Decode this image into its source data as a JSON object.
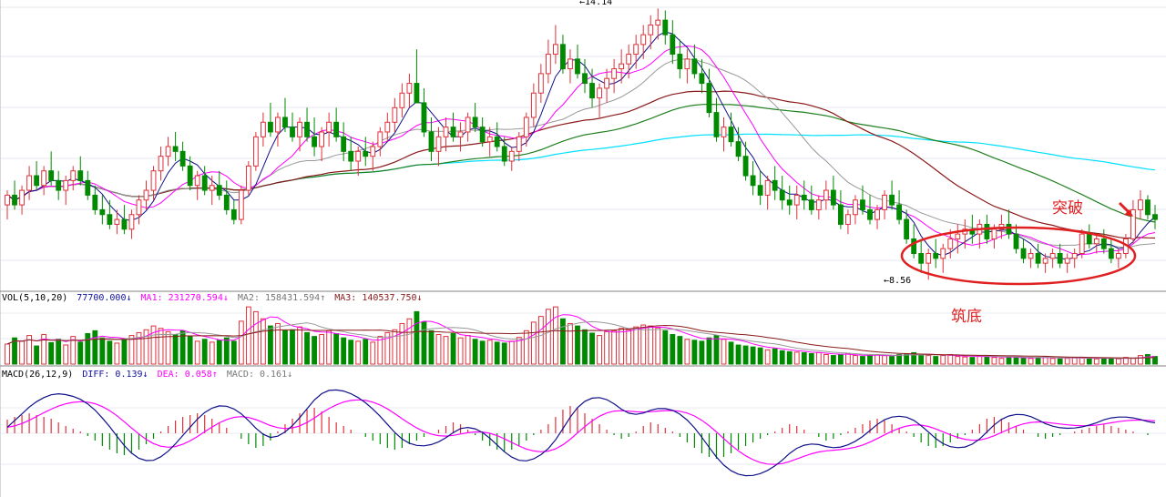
{
  "chart_data": {
    "type": "candlestick",
    "price_panel": {
      "high_label": "14.14",
      "low_label": "8.56",
      "annotation_breakout": "突破",
      "annotation_base": "筑底",
      "colors": {
        "up": "#e0303a",
        "down": "#008a00",
        "ma_short": "#10108a",
        "ma_mid": "#ff00ff",
        "ma_gray": "#999999",
        "ma_long_red": "#8b1a1a",
        "ma_long_green": "#208020",
        "ma_long_cyan": "#00e0ff",
        "circle": "#e02020"
      }
    },
    "volume_panel": {
      "header": "VOL(5,10,20)",
      "vol_value": "77700.000↓",
      "ma1": "MA1: 231270.594↓",
      "ma2": "MA2: 158431.594↑",
      "ma3": "MA3: 140537.750↓"
    },
    "macd_panel": {
      "header": "MACD(26,12,9)",
      "diff": "DIFF: 0.139↓",
      "dea": "DEA: 0.058↑",
      "macd": "MACD: 0.161↓"
    },
    "ohlc": [
      [
        10.1,
        10.4,
        9.8,
        10.3
      ],
      [
        10.3,
        10.6,
        10.0,
        10.1
      ],
      [
        10.1,
        10.5,
        9.9,
        10.4
      ],
      [
        10.4,
        10.9,
        10.2,
        10.7
      ],
      [
        10.7,
        11.0,
        10.4,
        10.5
      ],
      [
        10.5,
        10.9,
        10.3,
        10.8
      ],
      [
        10.8,
        11.2,
        10.5,
        10.6
      ],
      [
        10.6,
        10.8,
        10.2,
        10.4
      ],
      [
        10.4,
        10.7,
        10.1,
        10.6
      ],
      [
        10.6,
        10.9,
        10.4,
        10.8
      ],
      [
        10.8,
        11.1,
        10.5,
        10.6
      ],
      [
        10.6,
        10.8,
        10.2,
        10.3
      ],
      [
        10.3,
        10.5,
        9.9,
        10.0
      ],
      [
        10.0,
        10.3,
        9.7,
        9.9
      ],
      [
        9.9,
        10.2,
        9.6,
        9.7
      ],
      [
        9.7,
        10.0,
        9.5,
        9.8
      ],
      [
        9.8,
        10.1,
        9.5,
        9.6
      ],
      [
        9.6,
        10.0,
        9.4,
        9.9
      ],
      [
        9.9,
        10.3,
        9.7,
        10.2
      ],
      [
        10.2,
        10.6,
        10.0,
        10.4
      ],
      [
        10.4,
        10.9,
        10.2,
        10.8
      ],
      [
        10.8,
        11.3,
        10.6,
        11.1
      ],
      [
        11.1,
        11.5,
        10.9,
        11.3
      ],
      [
        11.3,
        11.6,
        11.0,
        11.2
      ],
      [
        11.2,
        11.4,
        10.8,
        10.9
      ],
      [
        10.9,
        11.1,
        10.4,
        10.5
      ],
      [
        10.5,
        10.8,
        10.2,
        10.7
      ],
      [
        10.7,
        10.9,
        10.3,
        10.4
      ],
      [
        10.4,
        10.7,
        10.1,
        10.5
      ],
      [
        10.5,
        10.8,
        10.2,
        10.3
      ],
      [
        10.3,
        10.6,
        9.9,
        10.0
      ],
      [
        10.0,
        10.2,
        9.7,
        9.8
      ],
      [
        9.8,
        10.5,
        9.7,
        10.4
      ],
      [
        10.4,
        11.0,
        10.3,
        10.9
      ],
      [
        10.9,
        11.6,
        10.8,
        11.5
      ],
      [
        11.5,
        12.0,
        11.3,
        11.8
      ],
      [
        11.8,
        12.2,
        11.5,
        11.6
      ],
      [
        11.6,
        12.0,
        11.3,
        11.9
      ],
      [
        11.9,
        12.3,
        11.6,
        11.7
      ],
      [
        11.7,
        12.0,
        11.4,
        11.5
      ],
      [
        11.5,
        11.9,
        11.2,
        11.8
      ],
      [
        11.8,
        12.1,
        11.4,
        11.5
      ],
      [
        11.5,
        11.9,
        11.1,
        11.3
      ],
      [
        11.3,
        11.7,
        11.0,
        11.6
      ],
      [
        11.6,
        12.0,
        11.3,
        11.8
      ],
      [
        11.8,
        12.1,
        11.4,
        11.5
      ],
      [
        11.5,
        11.8,
        11.0,
        11.2
      ],
      [
        11.2,
        11.5,
        10.8,
        11.0
      ],
      [
        11.0,
        11.3,
        10.7,
        11.2
      ],
      [
        11.2,
        11.5,
        10.9,
        11.1
      ],
      [
        11.1,
        11.4,
        10.8,
        11.3
      ],
      [
        11.3,
        11.7,
        11.1,
        11.6
      ],
      [
        11.6,
        12.0,
        11.4,
        11.8
      ],
      [
        11.8,
        12.3,
        11.6,
        12.1
      ],
      [
        12.1,
        12.6,
        11.9,
        12.4
      ],
      [
        12.4,
        12.8,
        12.1,
        12.6
      ],
      [
        12.6,
        13.3,
        12.4,
        12.2
      ],
      [
        12.2,
        12.5,
        11.5,
        11.6
      ],
      [
        11.6,
        11.9,
        11.0,
        11.2
      ],
      [
        11.2,
        11.7,
        10.9,
        11.5
      ],
      [
        11.5,
        11.9,
        11.2,
        11.7
      ],
      [
        11.7,
        12.0,
        11.4,
        11.5
      ],
      [
        11.5,
        11.8,
        11.2,
        11.6
      ],
      [
        11.6,
        12.0,
        11.4,
        11.9
      ],
      [
        11.9,
        12.2,
        11.6,
        11.7
      ],
      [
        11.7,
        11.9,
        11.3,
        11.4
      ],
      [
        11.4,
        11.7,
        11.1,
        11.5
      ],
      [
        11.5,
        11.8,
        11.2,
        11.3
      ],
      [
        11.3,
        11.5,
        10.9,
        11.0
      ],
      [
        11.0,
        11.3,
        10.8,
        11.2
      ],
      [
        11.2,
        11.6,
        11.0,
        11.5
      ],
      [
        11.5,
        12.0,
        11.3,
        11.9
      ],
      [
        11.9,
        12.6,
        11.7,
        12.4
      ],
      [
        12.4,
        13.0,
        12.2,
        12.8
      ],
      [
        12.8,
        13.5,
        12.6,
        13.2
      ],
      [
        13.2,
        13.8,
        13.0,
        13.4
      ],
      [
        13.4,
        13.6,
        12.8,
        12.9
      ],
      [
        12.9,
        13.3,
        12.6,
        13.1
      ],
      [
        13.1,
        13.4,
        12.7,
        12.8
      ],
      [
        12.8,
        13.1,
        12.4,
        12.6
      ],
      [
        12.6,
        12.9,
        12.1,
        12.3
      ],
      [
        12.3,
        12.6,
        11.9,
        12.5
      ],
      [
        12.5,
        12.9,
        12.2,
        12.7
      ],
      [
        12.7,
        13.1,
        12.4,
        12.9
      ],
      [
        12.9,
        13.3,
        12.6,
        13.0
      ],
      [
        13.0,
        13.4,
        12.7,
        13.2
      ],
      [
        13.2,
        13.6,
        12.9,
        13.4
      ],
      [
        13.4,
        13.8,
        13.1,
        13.6
      ],
      [
        13.6,
        14.0,
        13.3,
        13.8
      ],
      [
        13.8,
        14.14,
        13.5,
        13.9
      ],
      [
        13.9,
        14.1,
        13.4,
        13.6
      ],
      [
        13.6,
        13.9,
        13.0,
        13.2
      ],
      [
        13.2,
        13.5,
        12.7,
        12.9
      ],
      [
        12.9,
        13.3,
        12.6,
        13.1
      ],
      [
        13.1,
        13.4,
        12.7,
        12.8
      ],
      [
        12.8,
        13.1,
        12.4,
        12.6
      ],
      [
        12.6,
        12.9,
        11.9,
        12.0
      ],
      [
        12.0,
        12.3,
        11.4,
        11.5
      ],
      [
        11.5,
        11.9,
        11.2,
        11.7
      ],
      [
        11.7,
        12.0,
        11.3,
        11.4
      ],
      [
        11.4,
        11.7,
        11.0,
        11.1
      ],
      [
        11.1,
        11.4,
        10.6,
        10.7
      ],
      [
        10.7,
        11.0,
        10.3,
        10.5
      ],
      [
        10.5,
        10.8,
        10.1,
        10.3
      ],
      [
        10.3,
        10.7,
        10.0,
        10.6
      ],
      [
        10.6,
        10.9,
        10.2,
        10.4
      ],
      [
        10.4,
        10.7,
        10.0,
        10.2
      ],
      [
        10.2,
        10.5,
        9.9,
        10.1
      ],
      [
        10.1,
        10.5,
        9.8,
        10.3
      ],
      [
        10.3,
        10.6,
        10.0,
        10.2
      ],
      [
        10.2,
        10.5,
        9.9,
        10.0
      ],
      [
        10.0,
        10.3,
        9.8,
        10.2
      ],
      [
        10.2,
        10.6,
        10.0,
        10.4
      ],
      [
        10.4,
        10.7,
        10.0,
        10.1
      ],
      [
        10.1,
        10.4,
        9.6,
        9.7
      ],
      [
        9.7,
        10.0,
        9.5,
        9.9
      ],
      [
        9.9,
        10.3,
        9.7,
        10.2
      ],
      [
        10.2,
        10.5,
        9.9,
        10.0
      ],
      [
        10.0,
        10.3,
        9.7,
        9.8
      ],
      [
        9.8,
        10.1,
        9.6,
        10.0
      ],
      [
        10.0,
        10.4,
        9.8,
        10.3
      ],
      [
        10.3,
        10.6,
        10.0,
        10.1
      ],
      [
        10.1,
        10.4,
        9.7,
        9.8
      ],
      [
        9.8,
        10.0,
        9.3,
        9.4
      ],
      [
        9.4,
        9.7,
        9.0,
        9.1
      ],
      [
        9.1,
        9.4,
        8.7,
        8.9
      ],
      [
        8.9,
        9.2,
        8.56,
        9.1
      ],
      [
        9.1,
        9.4,
        8.8,
        9.0
      ],
      [
        9.0,
        9.3,
        8.7,
        9.2
      ],
      [
        9.2,
        9.6,
        9.0,
        9.4
      ],
      [
        9.4,
        9.7,
        9.1,
        9.5
      ],
      [
        9.5,
        9.8,
        9.2,
        9.6
      ],
      [
        9.6,
        9.9,
        9.3,
        9.5
      ],
      [
        9.5,
        9.8,
        9.2,
        9.7
      ],
      [
        9.7,
        9.9,
        9.3,
        9.4
      ],
      [
        9.4,
        9.7,
        9.2,
        9.6
      ],
      [
        9.6,
        9.9,
        9.4,
        9.7
      ],
      [
        9.7,
        10.0,
        9.4,
        9.5
      ],
      [
        9.5,
        9.7,
        9.1,
        9.2
      ],
      [
        9.2,
        9.4,
        8.9,
        9.0
      ],
      [
        9.0,
        9.2,
        8.8,
        9.1
      ],
      [
        9.1,
        9.3,
        8.8,
        8.9
      ],
      [
        8.9,
        9.1,
        8.7,
        9.0
      ],
      [
        9.0,
        9.2,
        8.8,
        9.1
      ],
      [
        9.1,
        9.3,
        8.8,
        8.9
      ],
      [
        8.9,
        9.1,
        8.7,
        9.0
      ],
      [
        9.0,
        9.2,
        8.8,
        9.1
      ],
      [
        9.1,
        9.6,
        9.0,
        9.5
      ],
      [
        9.5,
        9.7,
        9.2,
        9.3
      ],
      [
        9.3,
        9.5,
        9.1,
        9.4
      ],
      [
        9.4,
        9.6,
        9.1,
        9.2
      ],
      [
        9.2,
        9.4,
        8.9,
        9.0
      ],
      [
        9.0,
        9.2,
        8.8,
        9.1
      ],
      [
        9.1,
        9.5,
        9.0,
        9.4
      ],
      [
        9.4,
        10.2,
        9.3,
        10.0
      ],
      [
        10.0,
        10.4,
        9.8,
        10.2
      ],
      [
        10.2,
        10.3,
        9.8,
        9.9
      ],
      [
        9.9,
        10.1,
        9.6,
        9.8
      ]
    ],
    "volume": [
      42,
      55,
      48,
      60,
      38,
      62,
      45,
      52,
      40,
      58,
      46,
      64,
      70,
      55,
      48,
      44,
      52,
      60,
      66,
      72,
      80,
      75,
      68,
      62,
      70,
      58,
      48,
      52,
      46,
      50,
      55,
      48,
      90,
      120,
      110,
      95,
      80,
      85,
      70,
      72,
      78,
      66,
      58,
      62,
      70,
      64,
      55,
      50,
      48,
      52,
      46,
      58,
      66,
      72,
      85,
      95,
      110,
      88,
      70,
      62,
      58,
      64,
      55,
      60,
      52,
      48,
      50,
      46,
      44,
      48,
      56,
      70,
      88,
      100,
      115,
      120,
      95,
      85,
      80,
      72,
      65,
      60,
      68,
      70,
      75,
      72,
      78,
      82,
      80,
      76,
      70,
      62,
      58,
      52,
      50,
      48,
      55,
      60,
      52,
      46,
      40,
      38,
      36,
      34,
      30,
      32,
      28,
      26,
      25,
      24,
      22,
      24,
      20,
      18,
      20,
      22,
      18,
      16,
      18,
      20,
      18,
      16,
      20,
      22,
      24,
      20,
      18,
      16,
      18,
      20,
      16,
      15,
      14,
      16,
      18,
      14,
      12,
      14,
      15,
      13,
      12,
      14,
      16,
      12,
      11,
      12,
      13,
      14,
      12,
      11,
      13,
      12,
      11,
      14,
      12,
      18,
      20,
      16,
      15,
      12,
      14,
      16,
      18,
      14,
      12,
      14,
      18,
      26,
      16,
      12
    ],
    "macd_hist": [
      0.15,
      0.18,
      0.2,
      0.22,
      0.2,
      0.18,
      0.16,
      0.12,
      0.08,
      0.05,
      0.02,
      -0.03,
      -0.08,
      -0.14,
      -0.18,
      -0.22,
      -0.24,
      -0.22,
      -0.18,
      -0.12,
      -0.06,
      0.02,
      0.08,
      0.14,
      0.18,
      0.2,
      0.22,
      0.2,
      0.16,
      0.12,
      0.06,
      0.0,
      -0.06,
      -0.12,
      -0.16,
      -0.14,
      -0.08,
      0.02,
      0.1,
      0.16,
      0.22,
      0.26,
      0.28,
      0.24,
      0.18,
      0.12,
      0.08,
      0.04,
      0.0,
      -0.04,
      -0.08,
      -0.12,
      -0.16,
      -0.18,
      -0.16,
      -0.12,
      -0.08,
      -0.04,
      0.0,
      0.04,
      0.08,
      0.12,
      0.1,
      0.04,
      -0.02,
      -0.08,
      -0.14,
      -0.18,
      -0.2,
      -0.18,
      -0.14,
      -0.08,
      -0.02,
      0.04,
      0.1,
      0.18,
      0.26,
      0.3,
      0.28,
      0.22,
      0.16,
      0.1,
      0.04,
      -0.02,
      -0.06,
      -0.04,
      0.02,
      0.08,
      0.12,
      0.1,
      0.06,
      0.02,
      -0.04,
      -0.1,
      -0.16,
      -0.22,
      -0.26,
      -0.28,
      -0.26,
      -0.22,
      -0.18,
      -0.14,
      -0.1,
      -0.06,
      -0.02,
      0.02,
      0.06,
      0.1,
      0.08,
      0.04,
      0.0,
      -0.04,
      -0.08,
      -0.06,
      -0.02,
      0.02,
      0.06,
      0.1,
      0.14,
      0.16,
      0.14,
      0.1,
      0.06,
      0.02,
      -0.04,
      -0.1,
      -0.14,
      -0.16,
      -0.14,
      -0.1,
      -0.06,
      -0.02,
      0.04,
      0.1,
      0.16,
      0.18,
      0.16,
      0.12,
      0.08,
      0.04,
      0.0,
      -0.04,
      -0.06,
      -0.04,
      -0.02,
      0.0,
      0.02,
      0.04,
      0.06,
      0.08,
      0.1,
      0.08,
      0.06,
      0.04,
      0.02,
      0.0,
      -0.02,
      0.0,
      0.06,
      0.14,
      0.18,
      0.16,
      0.12
    ]
  }
}
